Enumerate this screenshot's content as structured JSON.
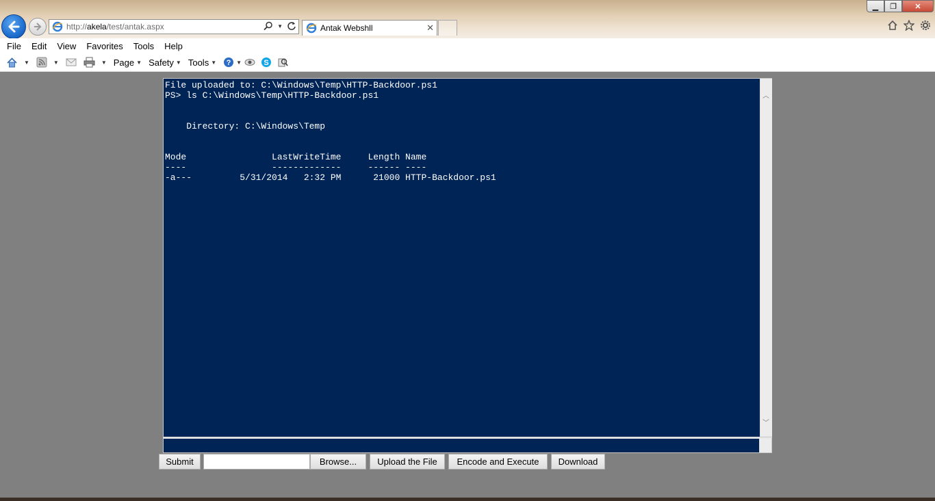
{
  "browser": {
    "url_prefix": "http://",
    "url_host": "akela",
    "url_path": "/test/antak.aspx",
    "tab_title": "Antak Websh­ll"
  },
  "menu": {
    "items": [
      "File",
      "Edit",
      "View",
      "Favorites",
      "Tools",
      "Help"
    ]
  },
  "command_bar": {
    "page_label": "Page",
    "safety_label": "Safety",
    "tools_label": "Tools"
  },
  "console": {
    "lines": [
      "File uploaded to: C:\\Windows\\Temp\\HTTP-Backdoor.ps1",
      "PS> ls C:\\Windows\\Temp\\HTTP-Backdoor.ps1",
      "",
      "",
      "    Directory: C:\\Windows\\Temp",
      "",
      "",
      "Mode                LastWriteTime     Length Name",
      "----                -------------     ------ ----",
      "-a---         5/31/2014   2:32 PM      21000 HTTP-Backdoor.ps1"
    ],
    "command_value": ""
  },
  "buttons": {
    "submit": "Submit",
    "browse": "Browse...",
    "upload": "Upload the File",
    "encode": "Encode and Execute",
    "download": "Download"
  }
}
